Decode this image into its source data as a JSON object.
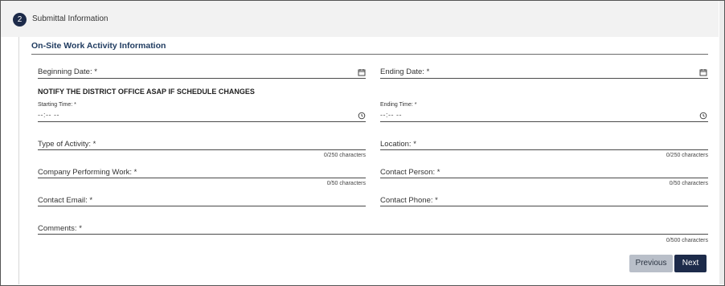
{
  "step": {
    "number": "2",
    "title": "Submittal Information"
  },
  "section_title": "On-Site Work Activity Information",
  "fields": {
    "beginning_date": {
      "label": "Beginning Date: *",
      "icon": "calendar-icon"
    },
    "ending_date": {
      "label": "Ending Date: *",
      "icon": "calendar-icon"
    },
    "starting_time": {
      "label": "Starting Time: *",
      "placeholder": "--:-- --",
      "icon": "clock-icon"
    },
    "ending_time": {
      "label": "Ending Time: *",
      "placeholder": "--:-- --",
      "icon": "clock-icon"
    },
    "type_of_activity": {
      "label": "Type of Activity: *",
      "counter": "0/250 characters"
    },
    "location": {
      "label": "Location: *",
      "counter": "0/250 characters"
    },
    "company_performing_work": {
      "label": "Company Performing Work: *",
      "counter": "0/50 characters"
    },
    "contact_person": {
      "label": "Contact Person: *",
      "counter": "0/50 characters"
    },
    "contact_email": {
      "label": "Contact Email: *"
    },
    "contact_phone": {
      "label": "Contact Phone: *"
    },
    "comments": {
      "label": "Comments: *",
      "counter": "0/500 characters"
    }
  },
  "notice": "NOTIFY THE DISTRICT OFFICE ASAP IF SCHEDULE CHANGES",
  "buttons": {
    "previous": "Previous",
    "next": "Next"
  }
}
